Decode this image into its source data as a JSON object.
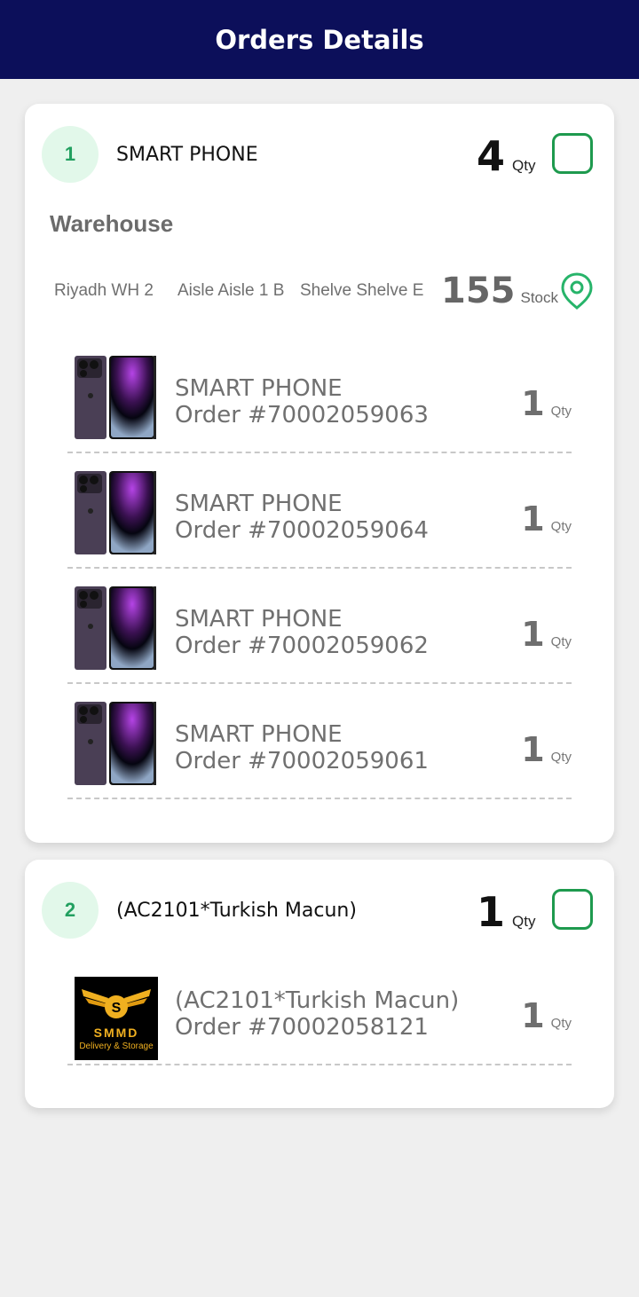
{
  "header": {
    "title": "Orders Details"
  },
  "groups": [
    {
      "index": "1",
      "title": "SMART PHONE",
      "qty": "4",
      "qty_unit": "Qty",
      "warehouse_label": "Warehouse",
      "location": {
        "warehouse": "Riyadh WH 2",
        "aisle": "Aisle Aisle 1 B",
        "shelve": "Shelve Shelve E",
        "stock": "155",
        "stock_unit": "Stock"
      },
      "items": [
        {
          "name": "SMART PHONE",
          "order": "Order #70002059063",
          "qty": "1",
          "qty_unit": "Qty"
        },
        {
          "name": "SMART PHONE",
          "order": "Order #70002059064",
          "qty": "1",
          "qty_unit": "Qty"
        },
        {
          "name": "SMART PHONE",
          "order": "Order #70002059062",
          "qty": "1",
          "qty_unit": "Qty"
        },
        {
          "name": "SMART PHONE",
          "order": "Order #70002059061",
          "qty": "1",
          "qty_unit": "Qty"
        }
      ]
    },
    {
      "index": "2",
      "title": "(AC2101*Turkish Macun)",
      "qty": "1",
      "qty_unit": "Qty",
      "items": [
        {
          "name": "(AC2101*Turkish Macun)",
          "order": "Order #70002058121",
          "qty": "1",
          "qty_unit": "Qty"
        }
      ]
    }
  ],
  "logo": {
    "letter": "S",
    "name": "SMMD",
    "tagline": "Delivery & Storage"
  },
  "colors": {
    "header": "#0c0f5a",
    "accent_green": "#1e9a4e",
    "badge_bg": "#e2f8ea"
  },
  "icons": {
    "location": "map-pin-icon",
    "check": "checkbox-icon"
  }
}
